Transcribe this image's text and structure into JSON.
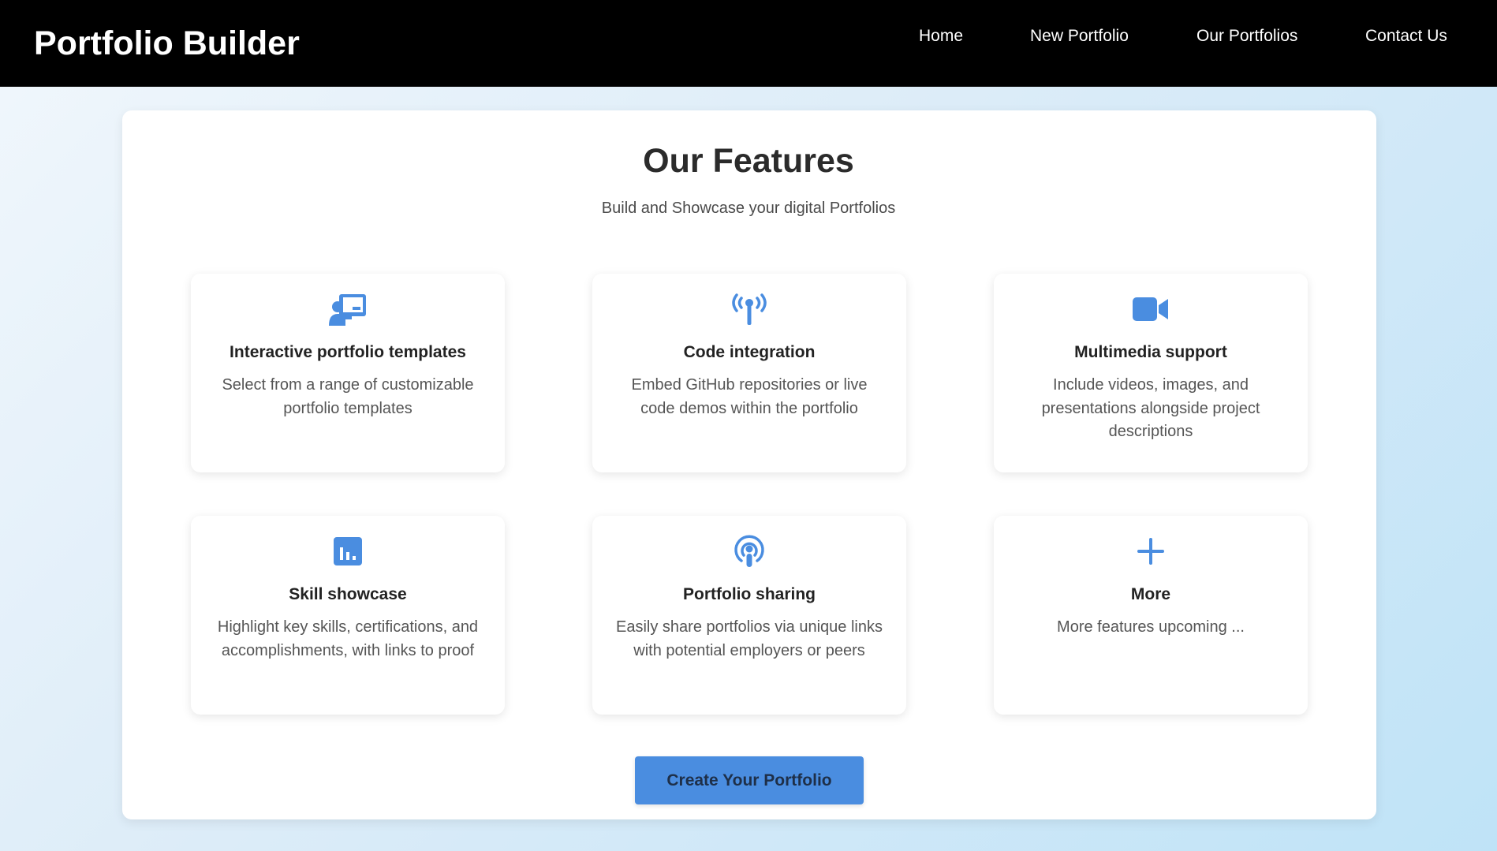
{
  "navbar": {
    "brand": "Portfolio Builder",
    "links": [
      "Home",
      "New Portfolio",
      "Our Portfolios",
      "Contact Us"
    ]
  },
  "main": {
    "title": "Our Features",
    "subtitle": "Build and Showcase your digital Portfolios",
    "cta_label": "Create Your Portfolio"
  },
  "features": [
    {
      "icon": "presentation-icon",
      "title": "Interactive portfolio templates",
      "desc": "Select from a range of customizable portfolio templates"
    },
    {
      "icon": "broadcast-tower-icon",
      "title": "Code integration",
      "desc": "Embed GitHub repositories or live code demos within the portfolio"
    },
    {
      "icon": "video-camera-icon",
      "title": "Multimedia support",
      "desc": "Include videos, images, and presentations alongside project descriptions"
    },
    {
      "icon": "bar-chart-icon",
      "title": "Skill showcase",
      "desc": "Highlight key skills, certifications, and accomplishments, with links to proof"
    },
    {
      "icon": "podcast-icon",
      "title": "Portfolio sharing",
      "desc": "Easily share portfolios via unique links with potential employers or peers"
    },
    {
      "icon": "plus-icon",
      "title": "More",
      "desc": "More features upcoming ..."
    }
  ],
  "colors": {
    "accent": "#4a8de0",
    "navbar": "#000000",
    "cta_text": "#1e2f48"
  }
}
